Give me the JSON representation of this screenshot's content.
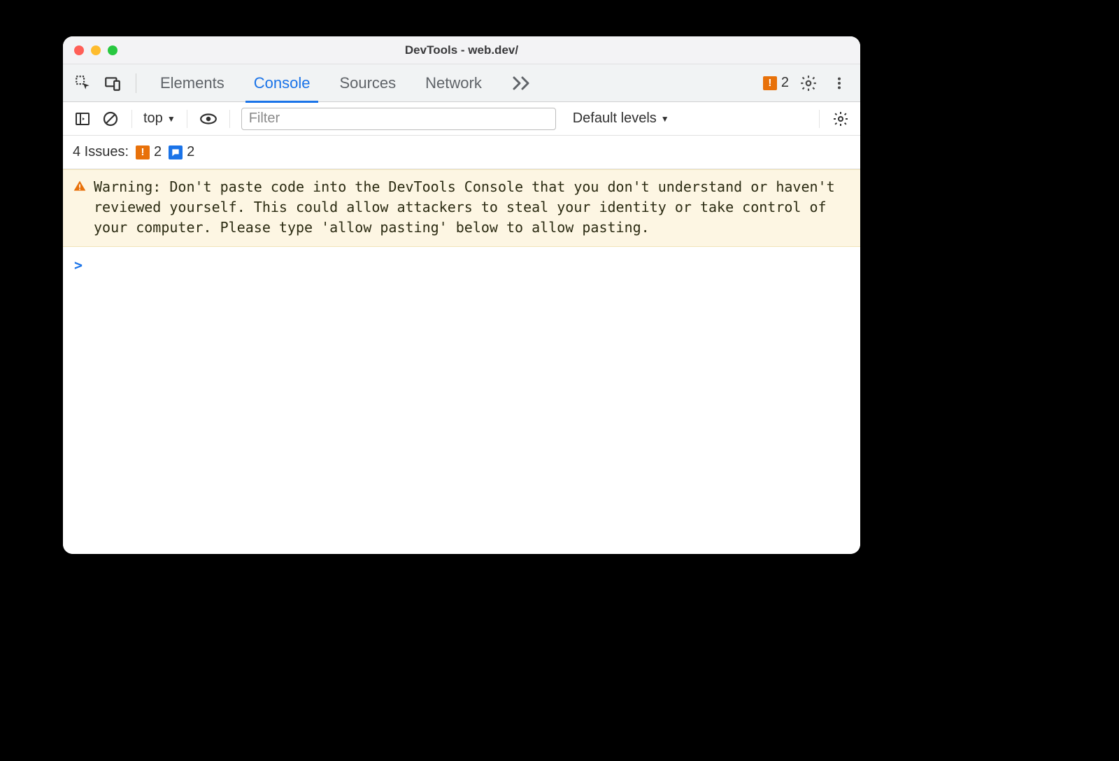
{
  "window": {
    "title": "DevTools - web.dev/"
  },
  "tabs": {
    "items": [
      "Elements",
      "Console",
      "Sources",
      "Network"
    ],
    "active_index": 1
  },
  "header_badge": {
    "error_count": "2"
  },
  "console_toolbar": {
    "context_label": "top",
    "filter_placeholder": "Filter",
    "levels_label": "Default levels"
  },
  "issues": {
    "label": "4 Issues:",
    "error_count": "2",
    "info_count": "2"
  },
  "warning": {
    "text": "Warning: Don't paste code into the DevTools Console that you don't understand or haven't reviewed yourself. This could allow attackers to steal your identity or take control of your computer. Please type 'allow pasting' below to allow pasting."
  }
}
